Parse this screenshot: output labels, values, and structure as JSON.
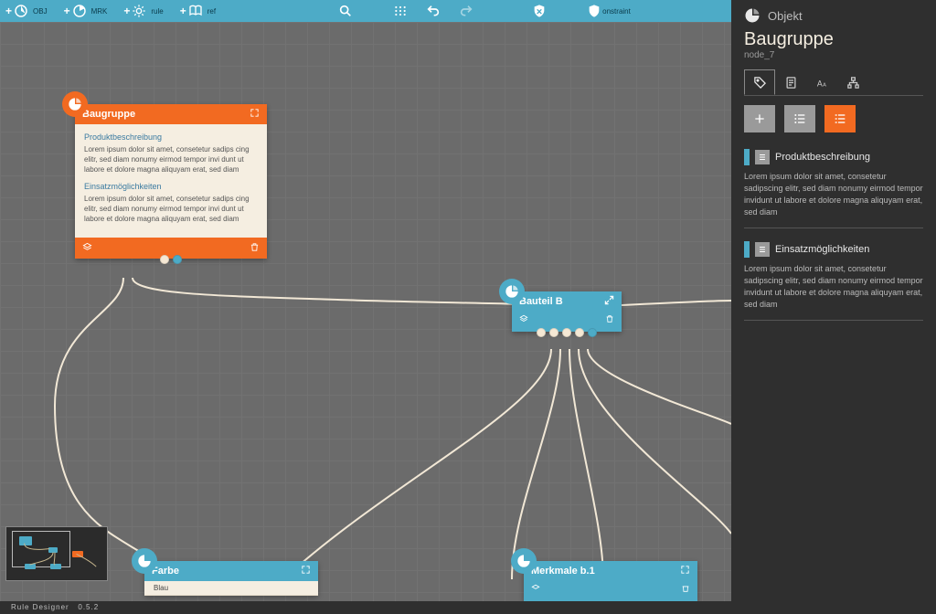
{
  "toolbar": {
    "items": [
      {
        "label": "OBJ"
      },
      {
        "label": "MRK"
      },
      {
        "label": "rule"
      },
      {
        "label": "ref"
      }
    ],
    "constraint_label": "onstraint"
  },
  "footer": {
    "app_name": "Rule Designer",
    "version": "0.5.2"
  },
  "panel": {
    "type_label": "Objekt",
    "title": "Baugruppe",
    "node_id": "node_7",
    "sections": [
      {
        "title": "Produktbeschreibung",
        "body": "Lorem ipsum dolor sit amet, consetetur sadipscing elitr, sed diam nonumy eirmod tempor invidunt ut labore et dolore magna aliquyam erat, sed diam"
      },
      {
        "title": "Einsatzmöglichkeiten",
        "body": "Lorem ipsum dolor sit amet, consetetur sadipscing elitr, sed diam nonumy eirmod tempor invidunt ut labore et dolore magna aliquyam erat, sed diam"
      }
    ]
  },
  "nodes": {
    "baugruppe": {
      "title": "Baugruppe",
      "sections": [
        {
          "title": "Produktbeschreibung",
          "body": "Lorem ipsum dolor sit amet, consetetur sadips cing elitr, sed diam nonumy eirmod tempor invi dunt ut labore et dolore magna aliquyam erat, sed diam voluptua. At vero eos et accusam et j"
        },
        {
          "title": "Einsatzmöglichkeiten",
          "body": "Lorem ipsum dolor sit amet, consetetur sadips cing elitr, sed diam nonumy eirmod tempor invi dunt ut labore et dolore magna aliquyam erat, sed diam voluptua. At vero eos et accusam et j"
        }
      ]
    },
    "bauteil_b": {
      "title": "Bauteil B"
    },
    "farbe": {
      "title": "Farbe",
      "list": [
        "Blau"
      ]
    },
    "merkmale": {
      "title": "Merkmale b.1"
    }
  },
  "colors": {
    "orange": "#f26a21",
    "blue": "#4dabc7",
    "cream": "#f5eee1"
  }
}
